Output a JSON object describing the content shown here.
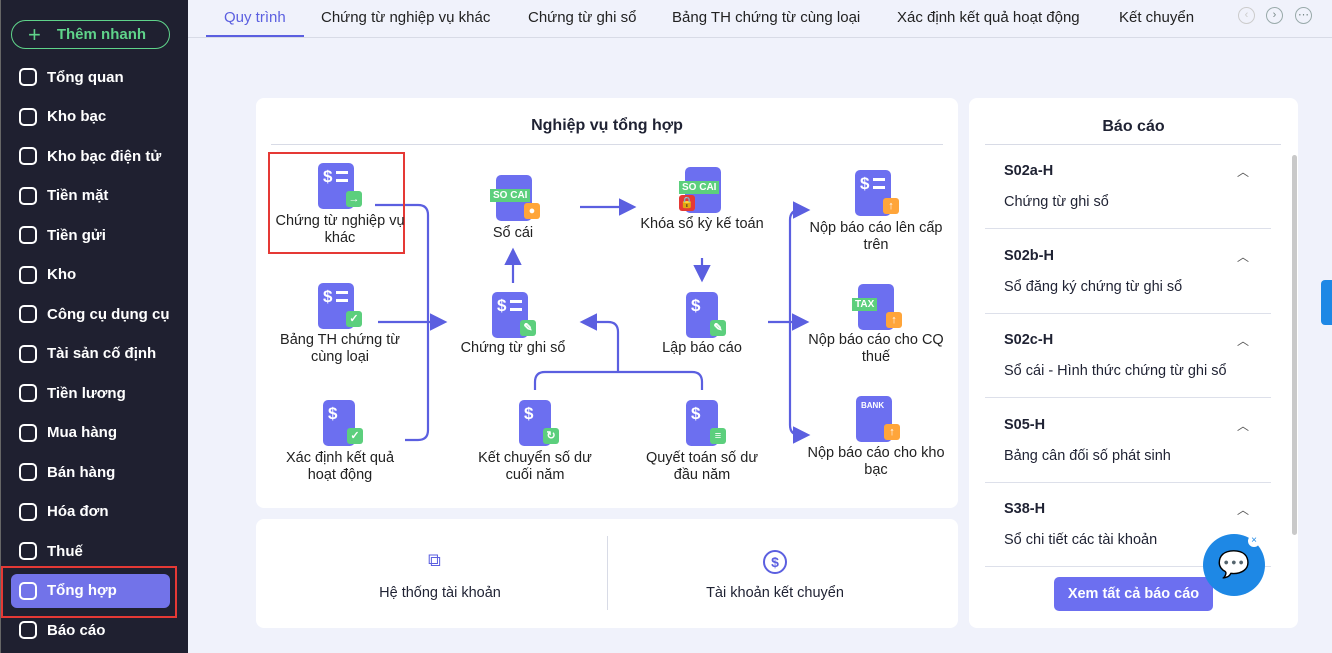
{
  "sidebar": {
    "quick_add": "Thêm nhanh",
    "items": [
      {
        "label": "Tổng quan",
        "icon": "pie-chart-icon"
      },
      {
        "label": "Kho bạc",
        "icon": "treasury-icon"
      },
      {
        "label": "Kho bạc điện tử",
        "icon": "e-treasury-icon"
      },
      {
        "label": "Tiền mặt",
        "icon": "cash-icon"
      },
      {
        "label": "Tiền gửi",
        "icon": "deposit-icon"
      },
      {
        "label": "Kho",
        "icon": "warehouse-icon"
      },
      {
        "label": "Công cụ dụng cụ",
        "icon": "tools-icon"
      },
      {
        "label": "Tài sản cố định",
        "icon": "fixed-asset-icon"
      },
      {
        "label": "Tiền lương",
        "icon": "salary-icon"
      },
      {
        "label": "Mua hàng",
        "icon": "cart-icon"
      },
      {
        "label": "Bán hàng",
        "icon": "sales-icon"
      },
      {
        "label": "Hóa đơn",
        "icon": "invoice-icon"
      },
      {
        "label": "Thuế",
        "icon": "tax-icon"
      },
      {
        "label": "Tổng hợp",
        "icon": "summary-icon",
        "active": true
      },
      {
        "label": "Báo cáo",
        "icon": "report-icon"
      }
    ]
  },
  "tabs": [
    "Quy trình",
    "Chứng từ nghiệp vụ khác",
    "Chứng từ ghi sổ",
    "Bảng TH chứng từ cùng loại",
    "Xác định kết quả hoạt động",
    "Kết chuyển"
  ],
  "flow": {
    "title": "Nghiệp vụ tổng hợp",
    "nodes": {
      "ctnvk": "Chứng từ nghiệp vụ khác",
      "socai": "Sổ cái",
      "khoaso": "Khóa sổ kỳ kế toán",
      "nopcaptren": "Nộp báo cáo lên cấp trên",
      "bangth": "Bảng TH chứng từ cùng loại",
      "ctgs": "Chứng từ ghi sổ",
      "lapbc": "Lập báo cáo",
      "nopthue": "Nộp báo cáo cho CQ thuế",
      "xacdinh": "Xác định kết quả hoạt động",
      "ketchuyen": "Kết chuyển số dư cuối năm",
      "quyettoan": "Quyết toán số dư đầu năm",
      "nopkhobac": "Nộp báo cáo cho kho bạc"
    },
    "tags": {
      "socai": "SO CAI",
      "tax": "TAX",
      "bank": "BANK"
    }
  },
  "shortcuts": [
    "Hệ thống tài khoản",
    "Tài khoản kết chuyển"
  ],
  "reports": {
    "title": "Báo cáo",
    "items": [
      {
        "code": "S02a-H",
        "name": "Chứng từ ghi sổ"
      },
      {
        "code": "S02b-H",
        "name": "Sổ đăng ký chứng từ ghi sổ"
      },
      {
        "code": "S02c-H",
        "name": "Sổ cái - Hình thức chứng từ ghi sổ"
      },
      {
        "code": "S05-H",
        "name": "Bảng cân đối số phát sinh"
      },
      {
        "code": "S38-H",
        "name": "Sổ chi tiết các tài khoản"
      }
    ],
    "view_all": "Xem tất cả báo cáo"
  },
  "colors": {
    "accent": "#6c6ff0",
    "sidebar": "#1f2030",
    "green": "#5fd38a"
  }
}
